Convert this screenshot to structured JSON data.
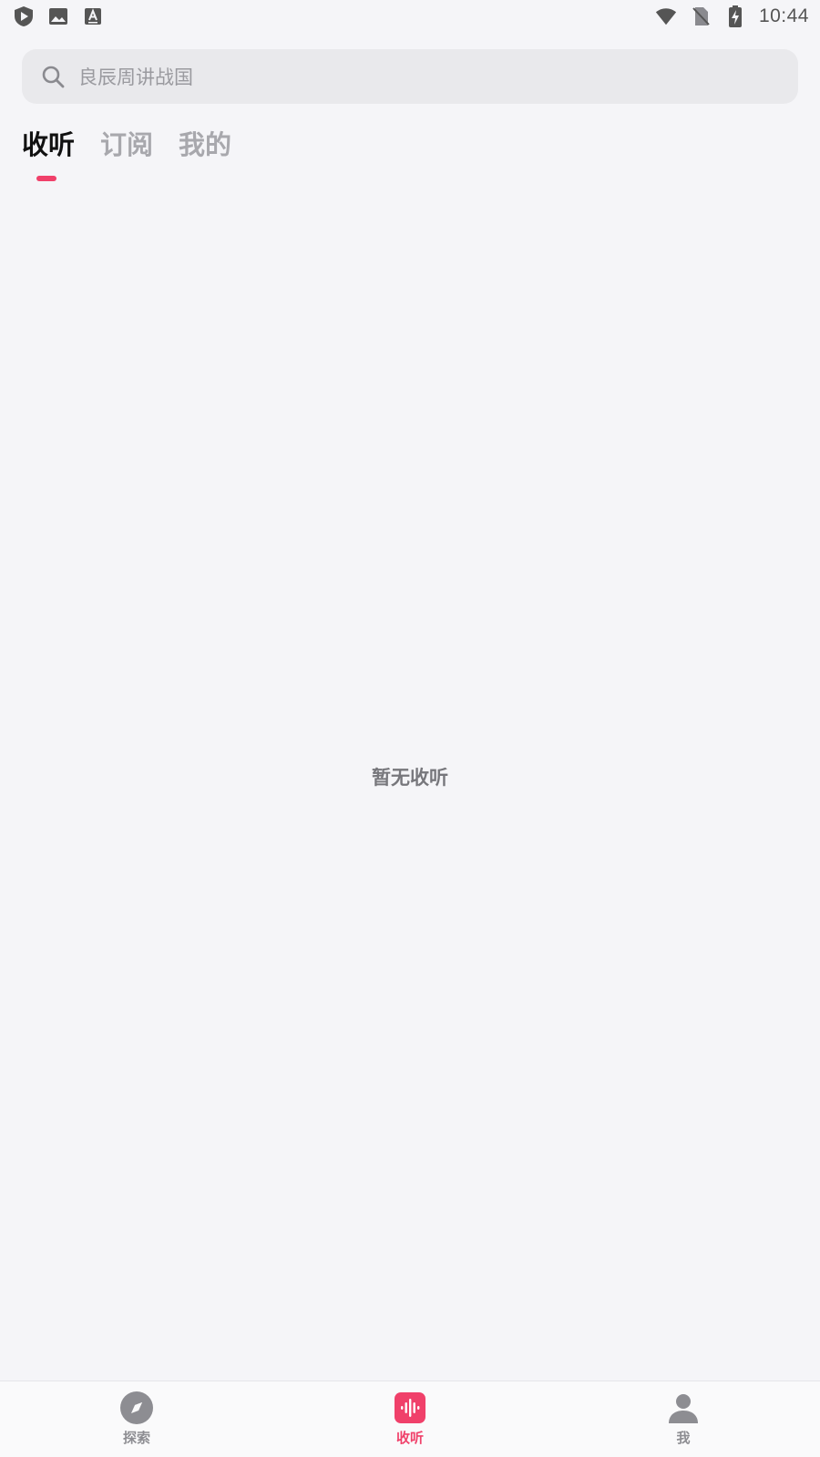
{
  "status_bar": {
    "left_icons": [
      "shield-play-icon",
      "image-icon",
      "font-a-icon"
    ],
    "right_icons": [
      "wifi-icon",
      "no-sim-icon",
      "battery-charging-icon"
    ],
    "time": "10:44"
  },
  "search": {
    "placeholder": "良辰周讲战国",
    "icon": "search-icon"
  },
  "tabs": [
    {
      "label": "收听",
      "active": true
    },
    {
      "label": "订阅",
      "active": false
    },
    {
      "label": "我的",
      "active": false
    }
  ],
  "empty_state": {
    "message": "暂无收听"
  },
  "bottom_nav": [
    {
      "label": "探索",
      "icon": "compass-icon",
      "active": false
    },
    {
      "label": "收听",
      "icon": "soundwave-icon",
      "active": true
    },
    {
      "label": "我",
      "icon": "person-icon",
      "active": false
    }
  ],
  "colors": {
    "accent": "#f0406a",
    "background": "#f5f5f8",
    "muted": "#a8a8ad"
  }
}
